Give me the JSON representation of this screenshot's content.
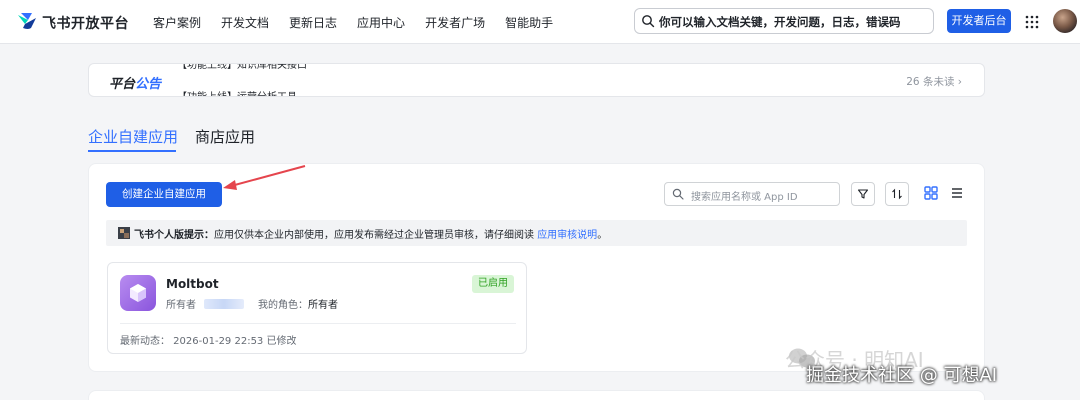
{
  "header": {
    "brand": "飞书开放平台",
    "nav": [
      "客户案例",
      "开发文档",
      "更新日志",
      "应用中心",
      "开发者广场",
      "智能助手"
    ],
    "search_value": "你可以输入文档关键，开发问题，日志，错误码",
    "dev_console": "开发者后台"
  },
  "notice": {
    "title_a": "平台",
    "title_b": "公告",
    "line1": "【功能上线】知识库相关接口",
    "line2": "【功能上线】运营分析工具",
    "unread": "26 条未读 ›"
  },
  "tabs": [
    "企业自建应用",
    "商店应用"
  ],
  "toolbar": {
    "create": "创建企业自建应用",
    "search_placeholder": "搜索应用名称或 App ID"
  },
  "tip": {
    "bold": "飞书个人版提示：",
    "text": "应用仅供本企业内部使用，应用发布需经过企业管理员审核，请仔细阅读 ",
    "link": "应用审核说明",
    "end": "。"
  },
  "app": {
    "name": "Moltbot",
    "status": "已启用",
    "owner_label": "所有者",
    "role_label": "我的角色：",
    "role_value": "所有者",
    "activity": "最新动态：  2026-01-29 22:53 已修改"
  },
  "watermark": {
    "line1": "公众号 · 明知AI",
    "line2": "掘金技术社区 @ 可想AI"
  },
  "colors": {
    "primary": "#1f5fe6",
    "link": "#3370ff",
    "success_bg": "#d9f5d6",
    "success_text": "#2ea121",
    "arrow": "#e5454d"
  }
}
